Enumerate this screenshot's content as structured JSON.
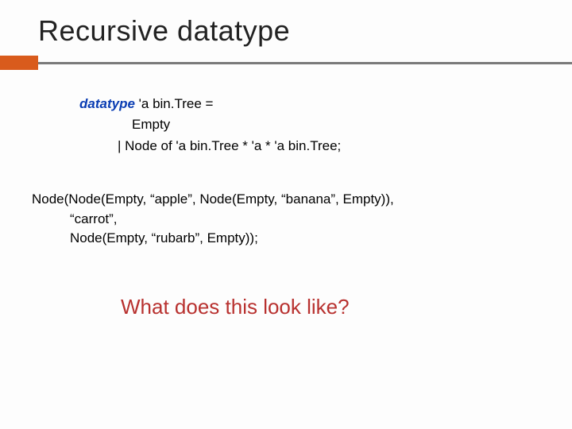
{
  "title": "Recursive datatype",
  "code": {
    "keyword": "datatype",
    "line1_rest": " 'a bin.Tree =",
    "line2": "Empty",
    "line3": "| Node of 'a bin.Tree * 'a * 'a bin.Tree;"
  },
  "example": {
    "line1": "Node(Node(Empty, “apple”, Node(Empty, “banana”, Empty)),",
    "line2": "“carrot”,",
    "line3": "Node(Empty, “rubarb”, Empty));"
  },
  "question": "What does this look like?"
}
